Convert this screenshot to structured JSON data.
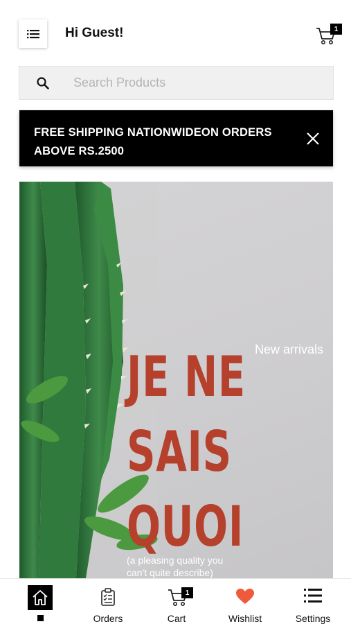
{
  "header": {
    "greeting": "Hi Guest!",
    "cart_count": "1"
  },
  "search": {
    "placeholder": "Search Products"
  },
  "banner": {
    "text": "FREE SHIPPING NATIONWIDEON ORDERS ABOVE RS.2500"
  },
  "hero": {
    "title_lines": [
      "JE NE",
      "SAIS",
      "QUOI"
    ],
    "tag": "New arrivals",
    "subtitle": "(a pleasing quality you can't quite describe)",
    "title_color": "#b5402c"
  },
  "tabbar": {
    "orders_label": "Orders",
    "cart_label": "Cart",
    "cart_count": "1",
    "wishlist_label": "Wishlist",
    "settings_label": "Settings",
    "wishlist_color": "#ef5a3c"
  }
}
